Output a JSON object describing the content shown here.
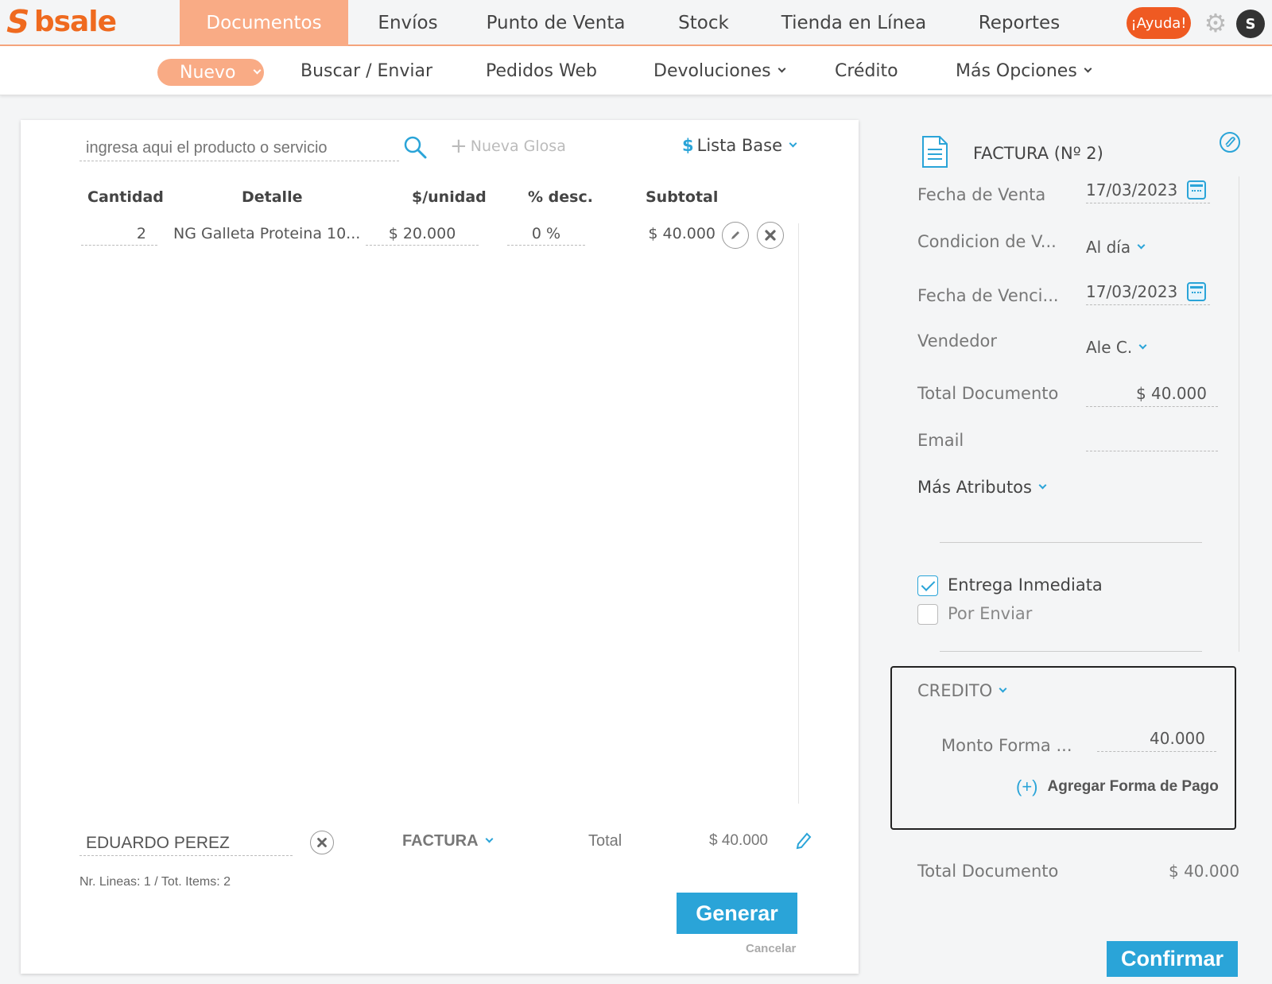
{
  "brand": {
    "name": "bsale",
    "color": "#ef6a1f"
  },
  "colors": {
    "accent": "#2aa4d8",
    "active_tab": "#f9ab85",
    "help": "#ef5a22"
  },
  "topnav": {
    "tabs": [
      "Documentos",
      "Envíos",
      "Punto de Venta",
      "Stock",
      "Tienda en Línea",
      "Reportes"
    ],
    "active": "Documentos",
    "help_label": "¡Ayuda!",
    "avatar_initial": "S"
  },
  "subnav": {
    "nuevo": "Nuevo",
    "items": [
      "Buscar / Enviar",
      "Pedidos Web",
      "Devoluciones",
      "Crédito",
      "Más Opciones"
    ]
  },
  "editor": {
    "search_placeholder": "ingresa aqui el producto o servicio",
    "nueva_glosa": "Nueva Glosa",
    "price_list": "Lista Base",
    "price_list_symbol": "$",
    "columns": [
      "Cantidad",
      "Detalle",
      "$/unidad",
      "% desc.",
      "Subtotal"
    ],
    "rows": [
      {
        "cantidad": "2",
        "detalle": "NG Galleta Proteina 10...",
        "unidad": "$ 20.000",
        "desc": "0 %",
        "subtotal": "$ 40.000"
      }
    ],
    "client": "EDUARDO PEREZ",
    "doc_type": "FACTURA",
    "total_label": "Total",
    "total_value": "$ 40.000",
    "lineas": "Nr. Lineas: 1 / Tot. Items: 2",
    "generar": "Generar",
    "cancelar": "Cancelar"
  },
  "summary": {
    "title": "FACTURA (Nº 2)",
    "fecha_venta_label": "Fecha de Venta",
    "fecha_venta": "17/03/2023",
    "condicion_label": "Condicion de V...",
    "condicion": "Al día",
    "fecha_venc_label": "Fecha de Venci...",
    "fecha_venc": "17/03/2023",
    "vendedor_label": "Vendedor",
    "vendedor": "Ale C.",
    "total_doc_label": "Total Documento",
    "total_doc": "$ 40.000",
    "email_label": "Email",
    "email": "",
    "mas_atributos": "Más Atributos",
    "entrega_inmediata": "Entrega Inmediata",
    "entrega_inmediata_checked": true,
    "por_enviar": "Por Enviar",
    "por_enviar_checked": false,
    "payment_method": "CREDITO",
    "monto_label": "Monto Forma ...",
    "monto": "40.000",
    "agregar_forma": "Agregar Forma de Pago",
    "agregar_icon": "(+)",
    "footer_total_label": "Total Documento",
    "footer_total": "$ 40.000",
    "confirmar": "Confirmar"
  }
}
